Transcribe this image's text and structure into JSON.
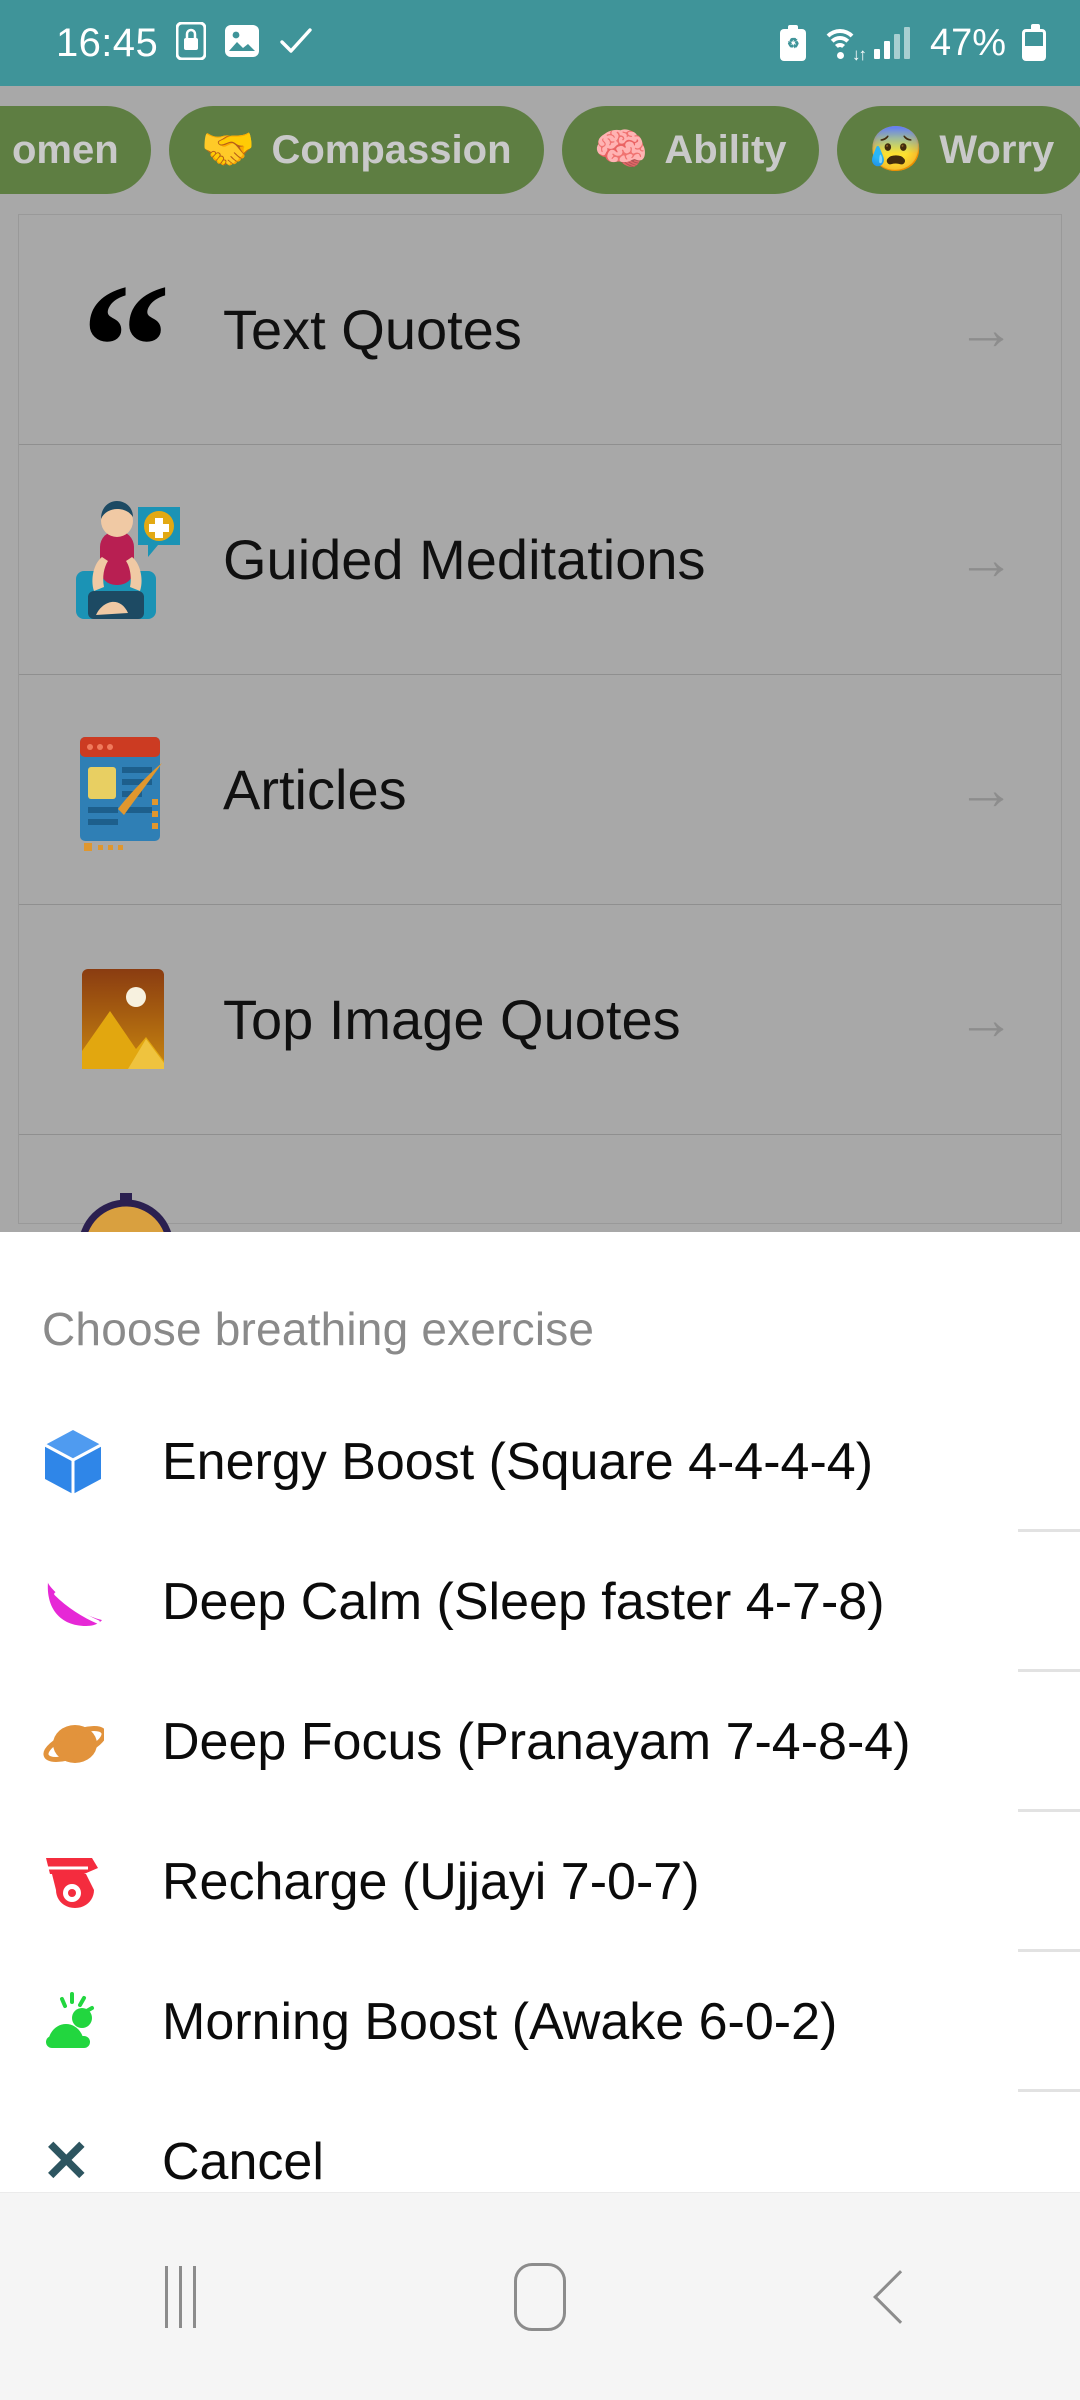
{
  "status_bar": {
    "time": "16:45",
    "battery_percent": "47%",
    "icons": {
      "screen_lock": "screen-lock-icon",
      "gallery": "gallery-icon",
      "check": "check-icon",
      "battery_saver": "battery-saver-icon",
      "wifi": "wifi-icon",
      "signal": "signal-icon",
      "battery": "battery-icon"
    },
    "check_glyph": "✓",
    "phone_glyph": "▯",
    "image_glyph": "▣",
    "recycle_glyph": "♻",
    "wifi_arrows": "↓↑",
    "background_color": "#3f9499"
  },
  "chips": {
    "background_color": "#5e7e42",
    "text_color": "#c9c9c9",
    "items": [
      {
        "label": "omen",
        "emoji": ""
      },
      {
        "label": "Compassion",
        "emoji": "🤝"
      },
      {
        "label": "Ability",
        "emoji": "🧠"
      },
      {
        "label": "Worry",
        "emoji": "😰"
      }
    ]
  },
  "content_list": {
    "arrow_glyph": "→",
    "items": [
      {
        "title": "Text Quotes",
        "icon": "quote-icon",
        "emoji": "“"
      },
      {
        "title": "Guided Meditations",
        "icon": "meditation-icon",
        "emoji": "🧘"
      },
      {
        "title": "Articles",
        "icon": "article-icon",
        "emoji": "📰"
      },
      {
        "title": "Top Image Quotes",
        "icon": "image-icon",
        "emoji": "🖼"
      }
    ]
  },
  "bottom_sheet": {
    "title": "Choose breathing exercise",
    "options": [
      {
        "label": "Energy Boost (Square 4-4-4-4)",
        "icon": "cube-icon",
        "emoji": "📦",
        "color": "#2f86e8"
      },
      {
        "label": "Deep Calm (Sleep faster 4-7-8)",
        "icon": "leaf-icon",
        "emoji": "🍃",
        "color": "#e628d6"
      },
      {
        "label": "Deep Focus (Pranayam 7-4-8-4)",
        "icon": "planet-icon",
        "emoji": "🪐",
        "color": "#e2933c"
      },
      {
        "label": "Recharge (Ujjayi 7-0-7)",
        "icon": "whistle-icon",
        "emoji": "🔔",
        "color": "#f42c3e"
      },
      {
        "label": "Morning Boost (Awake 6-0-2)",
        "icon": "sunrise-icon",
        "emoji": "🌤",
        "color": "#22d63f"
      }
    ],
    "cancel": {
      "label": "Cancel",
      "icon": "close-icon",
      "glyph": "✕",
      "color": "#2d5560"
    }
  },
  "nav_bar": {
    "recents": "recents-button",
    "home": "home-button",
    "back": "back-button"
  }
}
